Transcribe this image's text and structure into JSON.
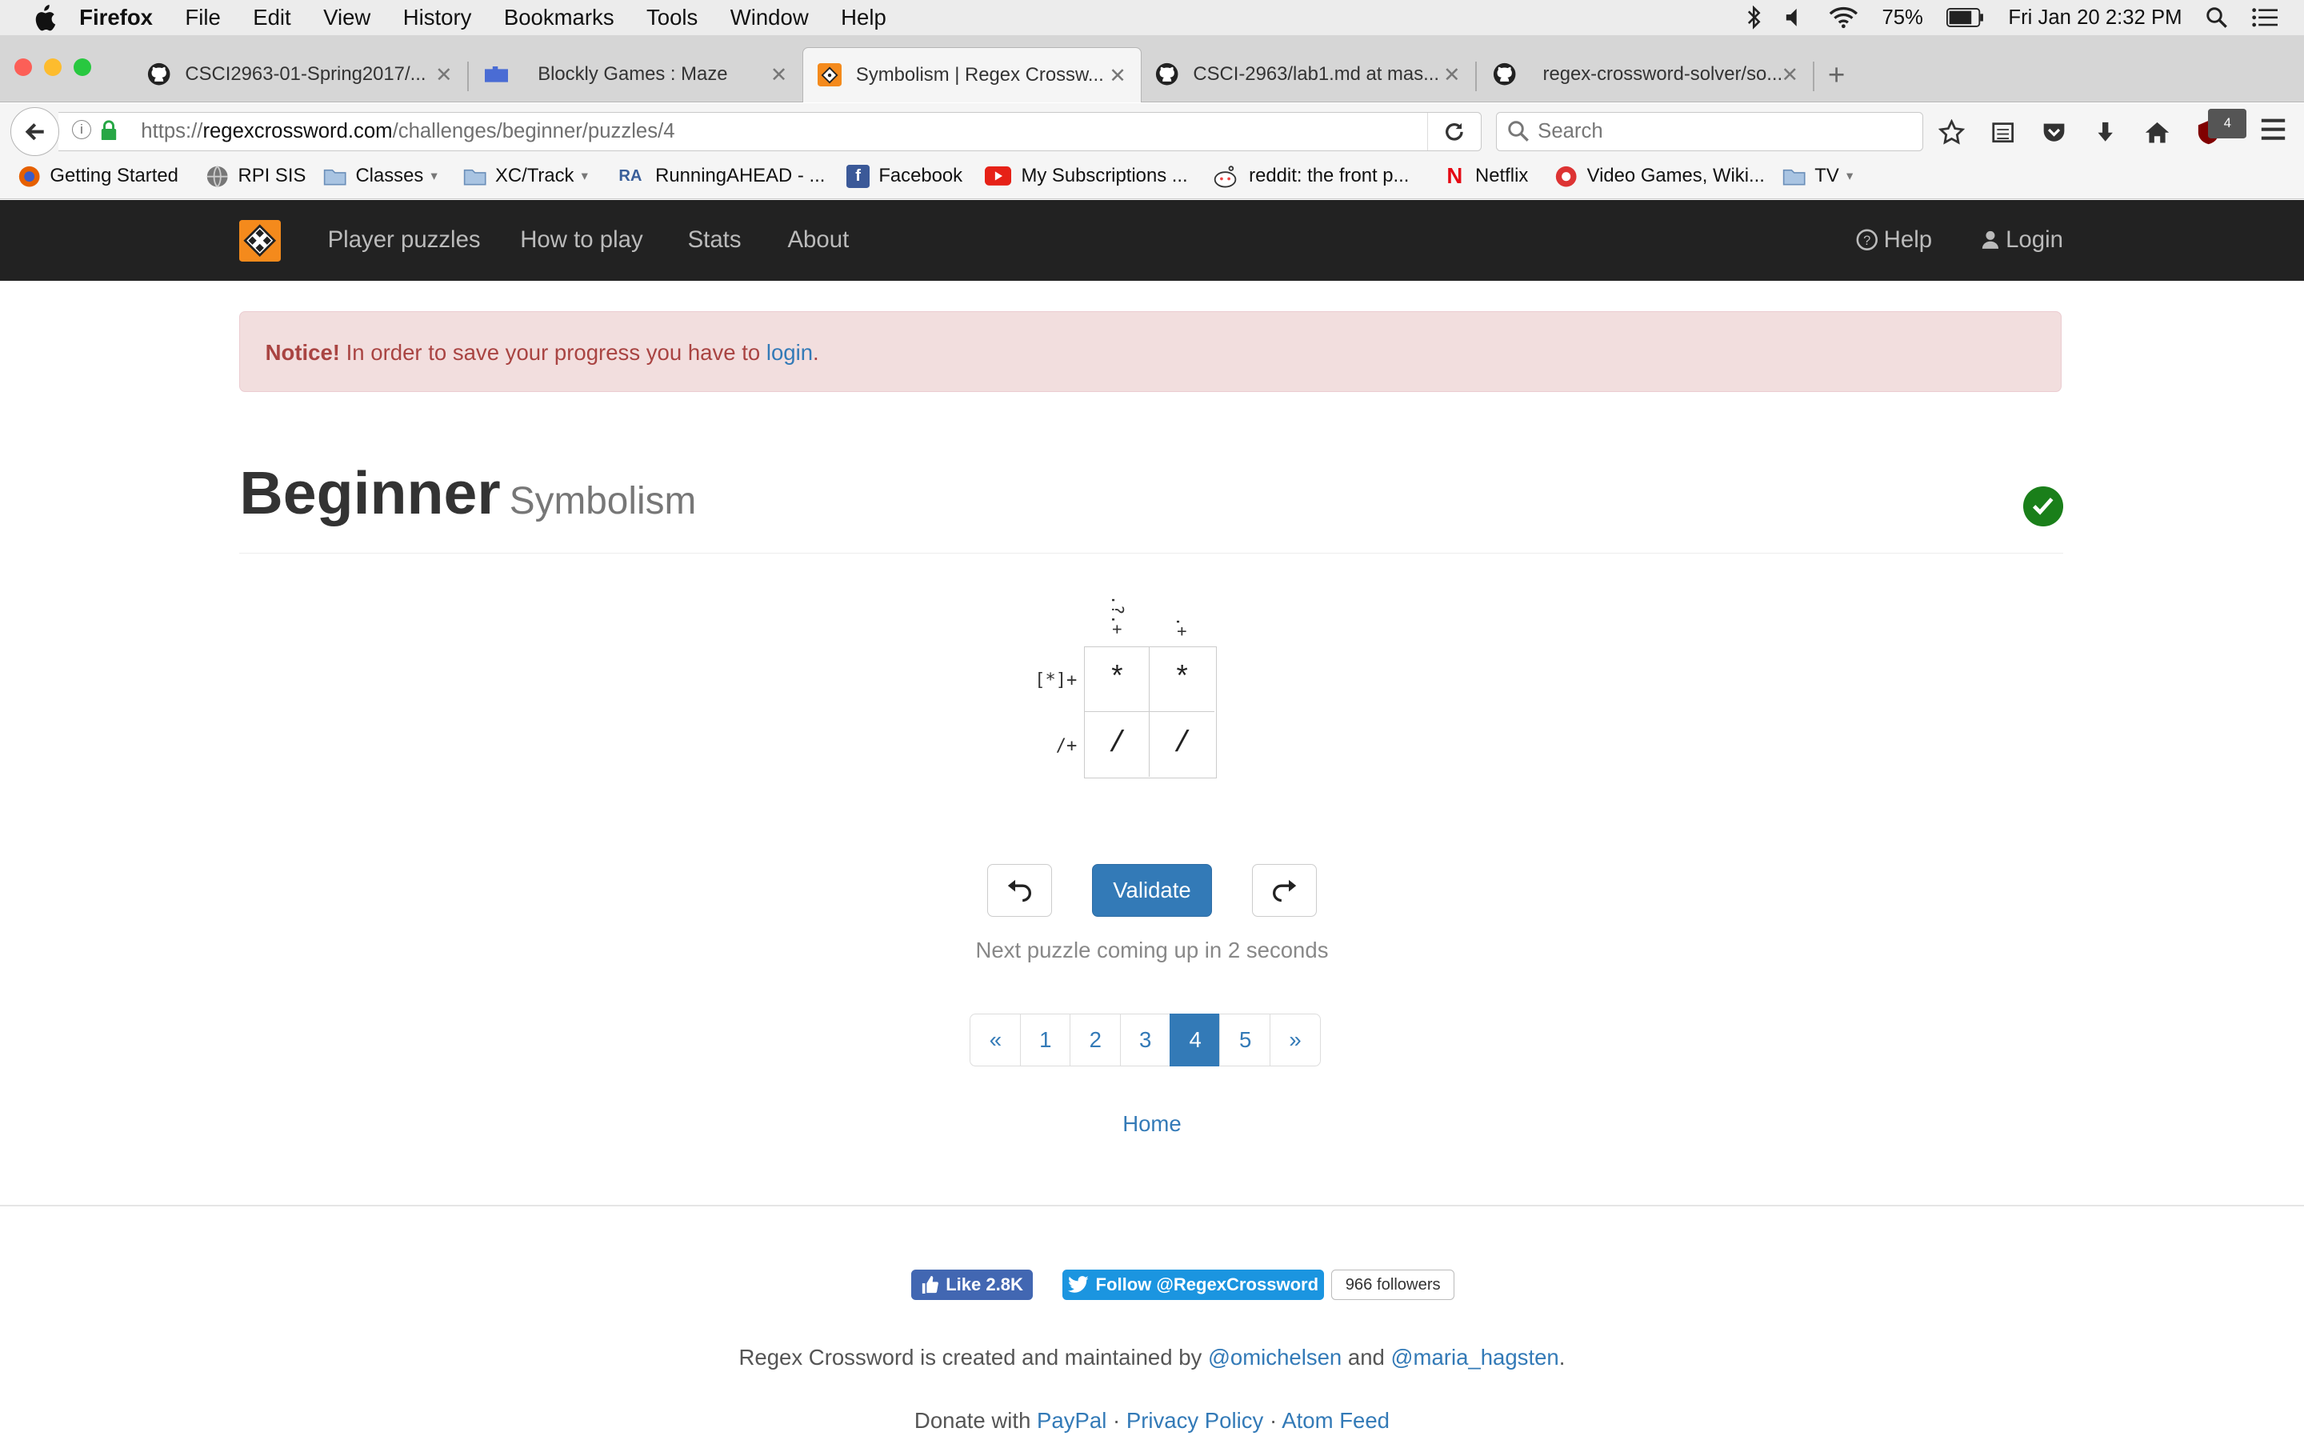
{
  "menubar": {
    "app": "Firefox",
    "items": [
      "File",
      "Edit",
      "View",
      "History",
      "Bookmarks",
      "Tools",
      "Window",
      "Help"
    ],
    "battery": "75%",
    "clock": "Fri Jan 20  2:32 PM"
  },
  "tabs": [
    {
      "title": "CSCI2963-01-Spring2017/...",
      "icon": "github-icon"
    },
    {
      "title": "Blockly Games : Maze",
      "icon": "puzzle-icon"
    },
    {
      "title": "Symbolism | Regex Crossw...",
      "icon": "regex-logo-icon"
    },
    {
      "title": "CSCI-2963/lab1.md at mas...",
      "icon": "github-icon"
    },
    {
      "title": "regex-crossword-solver/so...",
      "icon": "github-icon"
    }
  ],
  "urlbar": {
    "prefix": "https://",
    "domain": "regexcrossword.com",
    "path": "/challenges/beginner/puzzles/4"
  },
  "searchbar": {
    "placeholder": "Search"
  },
  "addon_badge": "4",
  "bookmarks": [
    {
      "label": "Getting Started",
      "icon": "firefox-icon"
    },
    {
      "label": "RPI SIS",
      "icon": "globe-icon"
    },
    {
      "label": "Classes",
      "icon": "folder-icon"
    },
    {
      "label": "XC/Track",
      "icon": "folder-icon"
    },
    {
      "label": "RunningAHEAD - ...",
      "icon": "ra-icon",
      "glyph": "RA"
    },
    {
      "label": "Facebook",
      "icon": "facebook-icon",
      "glyph": "f"
    },
    {
      "label": "My Subscriptions ...",
      "icon": "youtube-icon"
    },
    {
      "label": "reddit: the front p...",
      "icon": "reddit-icon"
    },
    {
      "label": "Netflix",
      "icon": "netflix-icon",
      "glyph": "N"
    },
    {
      "label": "Video Games, Wiki...",
      "icon": "wiki-icon"
    },
    {
      "label": "TV",
      "icon": "folder-icon"
    }
  ],
  "sitenav": {
    "links": [
      "Player puzzles",
      "How to play",
      "Stats",
      "About"
    ],
    "help": "Help",
    "login": "Login"
  },
  "notice": {
    "strong": "Notice!",
    "text": "In order to save your progress you have to",
    "link": "login",
    "end": "."
  },
  "heading": {
    "title": "Beginner",
    "subtitle": "Symbolism"
  },
  "puzzle": {
    "column_clues": [
      ".?.+",
      ".+"
    ],
    "row_clues": [
      "[*]+",
      "/+"
    ],
    "cells": [
      [
        "*",
        "*"
      ],
      [
        "/",
        "/"
      ]
    ]
  },
  "controls": {
    "validate": "Validate",
    "next_message": "Next puzzle coming up in 2 seconds"
  },
  "pagination": {
    "prev": "«",
    "pages": [
      "1",
      "2",
      "3",
      "4",
      "5"
    ],
    "active": "4",
    "next": "»"
  },
  "home_link": "Home",
  "social": {
    "like": "Like 2.8K",
    "follow": "Follow @RegexCrossword",
    "followers": "966 followers"
  },
  "footer": {
    "created_text": "Regex Crossword is created and maintained by",
    "author1": "@omichelsen",
    "and": "and",
    "author2": "@maria_hagsten",
    "period": ".",
    "donate_text": "Donate with",
    "paypal": "PayPal",
    "privacy": "Privacy Policy",
    "atom": "Atom Feed",
    "sep": "·"
  },
  "colors": {
    "accent": "#337ab7",
    "logo": "#f48a1c",
    "navbar": "#222222",
    "notice_bg": "#f2dede",
    "success": "#1a7f1a"
  }
}
